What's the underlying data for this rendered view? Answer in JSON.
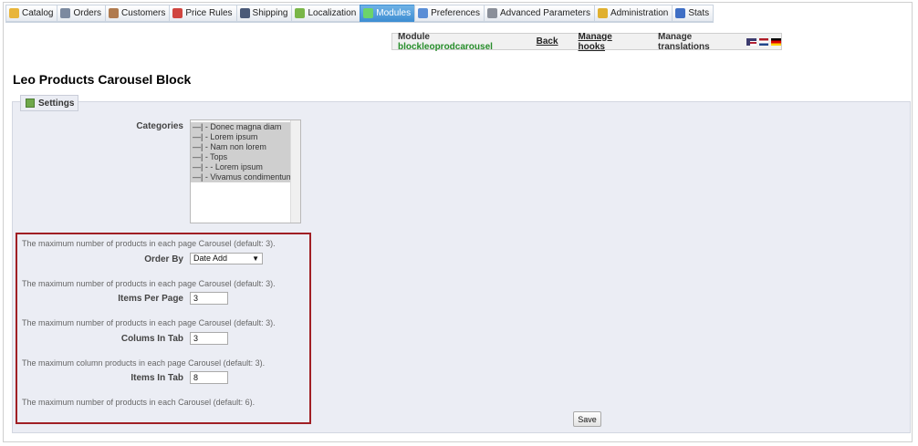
{
  "nav": {
    "tabs": [
      {
        "label": "Catalog",
        "icon": "folder-icon",
        "color": "#e8b53a",
        "active": false
      },
      {
        "label": "Orders",
        "icon": "cart-icon",
        "color": "#7c8aa0",
        "active": false
      },
      {
        "label": "Customers",
        "icon": "user-icon",
        "color": "#b07b4f",
        "active": false
      },
      {
        "label": "Price Rules",
        "icon": "price-tag-icon",
        "color": "#d0453f",
        "active": false
      },
      {
        "label": "Shipping",
        "icon": "truck-icon",
        "color": "#4a5a78",
        "active": false
      },
      {
        "label": "Localization",
        "icon": "globe-icon",
        "color": "#7ab648",
        "active": false
      },
      {
        "label": "Modules",
        "icon": "puzzle-icon",
        "color": "#6cd46a",
        "active": true
      },
      {
        "label": "Preferences",
        "icon": "screen-icon",
        "color": "#5a8ed6",
        "active": false
      },
      {
        "label": "Advanced Parameters",
        "icon": "wrench-icon",
        "color": "#8a8f99",
        "active": false
      },
      {
        "label": "Administration",
        "icon": "key-icon",
        "color": "#e0b02f",
        "active": false
      },
      {
        "label": "Stats",
        "icon": "bar-chart-icon",
        "color": "#3f6fc5",
        "active": false
      }
    ]
  },
  "module_bar": {
    "module_label": "Module",
    "module_name": "blockleoprodcarousel",
    "back": "Back",
    "manage_hooks": "Manage hooks",
    "manage_translations": "Manage translations"
  },
  "page_title": "Leo Products Carousel Block",
  "settings": {
    "legend": "Settings",
    "categories_label": "Categories",
    "categories": [
      "—| - Donec magna diam",
      "—| - Lorem ipsum",
      "—| - Nam non lorem",
      "—| - Tops",
      "—| - - Lorem ipsum",
      "—| - Vivamus condimentum"
    ],
    "desc_carousel": "The maximum number of products in each page Carousel (default: 3).",
    "order_by_label": "Order By",
    "order_by_value": "Date Add",
    "desc_order_by": "The maximum number of products in each page Carousel (default: 3).",
    "items_per_page_label": "Items Per Page",
    "items_per_page_value": "3",
    "desc_items_per_page": "The maximum number of products in each page Carousel (default: 3).",
    "colums_in_tab_label": "Colums In Tab",
    "colums_in_tab_value": "3",
    "desc_colums_in_tab": "The maximum column products in each page Carousel (default: 3).",
    "items_in_tab_label": "Items In Tab",
    "items_in_tab_value": "8",
    "desc_items_in_tab": "The maximum number of products in each Carousel (default: 6).",
    "save": "Save"
  },
  "colors": {
    "active_tab": "#3f8fd3",
    "module_name": "#268d2a",
    "highlight_border": "#a01f24",
    "panel_bg": "#ebedf4"
  }
}
